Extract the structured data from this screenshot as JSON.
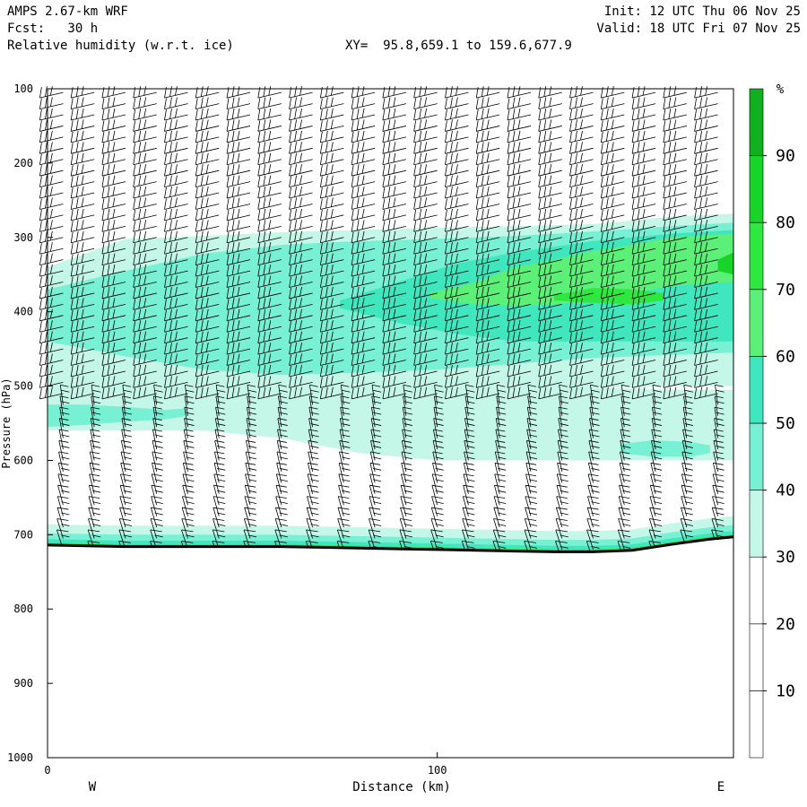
{
  "header": {
    "model": "AMPS 2.67-km WRF",
    "forecast": "Fcst:   30 h",
    "field": "Relative humidity (w.r.t. ice)",
    "xy": "XY=  95.8,659.1 to 159.6,677.9",
    "init": "Init: 12 UTC Thu 06 Nov 25",
    "valid": "Valid: 18 UTC Fri 07 Nov 25"
  },
  "chart_data": {
    "type": "heatmap",
    "title": "Relative humidity (w.r.t. ice)",
    "xlabel": "Distance (km)",
    "ylabel": "Pressure (hPa)",
    "xlim": [
      0,
      176
    ],
    "ylim": [
      1000,
      100
    ],
    "x_ticks": [
      0,
      100
    ],
    "y_ticks": [
      100,
      200,
      300,
      400,
      500,
      600,
      700,
      800,
      900,
      1000
    ],
    "x_end_labels": {
      "left": "W",
      "right": "E"
    },
    "colorbar": {
      "unit": "%",
      "levels": [
        0,
        10,
        20,
        30,
        40,
        50,
        60,
        70,
        80,
        90,
        100
      ],
      "tick_labels": [
        10,
        20,
        30,
        40,
        50,
        60,
        70,
        80,
        90
      ],
      "colors": [
        "#ffffff",
        "#ffffff",
        "#ffffff",
        "#c4f7e8",
        "#78f0d4",
        "#40e6be",
        "#5cf078",
        "#2ee840",
        "#18d428",
        "#10b020",
        "#0a7a14"
      ]
    },
    "terrain_surface": {
      "x_km": [
        0,
        10,
        20,
        30,
        40,
        50,
        60,
        70,
        80,
        90,
        100,
        110,
        120,
        130,
        140,
        150,
        160,
        170,
        176
      ],
      "pressure": [
        714,
        715,
        716,
        716,
        716,
        716,
        716,
        717,
        718,
        719,
        720,
        721,
        722,
        723,
        723,
        721,
        713,
        706,
        703
      ]
    },
    "rh_regions": [
      {
        "level": 35,
        "x_km": [
          0,
          20,
          40,
          60,
          80,
          100,
          120,
          140,
          160,
          176
        ],
        "p_top": [
          340,
          302,
          298,
          293,
          290,
          287,
          285,
          282,
          272,
          268
        ],
        "p_bottom": [
          545,
          540,
          525,
          515,
          510,
          507,
          505,
          502,
          500,
          500
        ]
      },
      {
        "level": 35,
        "x_km": [
          0,
          20,
          40,
          60,
          80,
          100,
          120,
          140,
          160,
          176
        ],
        "p_top": [
          545,
          540,
          525,
          515,
          510,
          507,
          505,
          502,
          505,
          505
        ],
        "p_bottom": [
          560,
          560,
          560,
          570,
          590,
          600,
          600,
          600,
          600,
          600
        ]
      },
      {
        "level": 45,
        "x_km": [
          0,
          20,
          40,
          60,
          80,
          100,
          120,
          140,
          160,
          176
        ],
        "p_top": [
          370,
          345,
          322,
          310,
          305,
          302,
          298,
          292,
          285,
          280
        ],
        "p_bottom": [
          440,
          460,
          478,
          485,
          482,
          478,
          470,
          462,
          458,
          455
        ]
      },
      {
        "level": 45,
        "x_km": [
          0,
          10,
          20,
          30,
          36
        ],
        "p_top": [
          525,
          525,
          528,
          532,
          530
        ],
        "p_bottom": [
          555,
          552,
          548,
          545,
          540
        ]
      },
      {
        "level": 45,
        "x_km": [
          147,
          155,
          165,
          170
        ],
        "p_top": [
          578,
          573,
          575,
          580
        ],
        "p_bottom": [
          590,
          595,
          595,
          590
        ]
      },
      {
        "level": 55,
        "x_km": [
          75,
          90,
          105,
          120,
          140,
          160,
          176
        ],
        "p_top": [
          385,
          360,
          335,
          320,
          305,
          295,
          290
        ],
        "p_bottom": [
          395,
          415,
          430,
          440,
          440,
          440,
          440
        ]
      },
      {
        "level": 65,
        "x_km": [
          98,
          110,
          120,
          130,
          140,
          150,
          160,
          176
        ],
        "p_top": [
          375,
          360,
          340,
          330,
          318,
          310,
          300,
          295
        ],
        "p_bottom": [
          382,
          390,
          392,
          390,
          385,
          375,
          365,
          360
        ]
      },
      {
        "level": 75,
        "x_km": [
          130,
          140,
          150,
          158
        ],
        "p_top": [
          378,
          368,
          370,
          375
        ],
        "p_bottom": [
          385,
          388,
          390,
          385
        ]
      },
      {
        "level": 85,
        "x_km": [
          172,
          176
        ],
        "p_top": [
          330,
          320
        ],
        "p_bottom": [
          345,
          350
        ]
      }
    ],
    "wind_barbs": "half-barb and full-barb wind barbs on a regular grid, ~22 columns x ~30 levels"
  }
}
